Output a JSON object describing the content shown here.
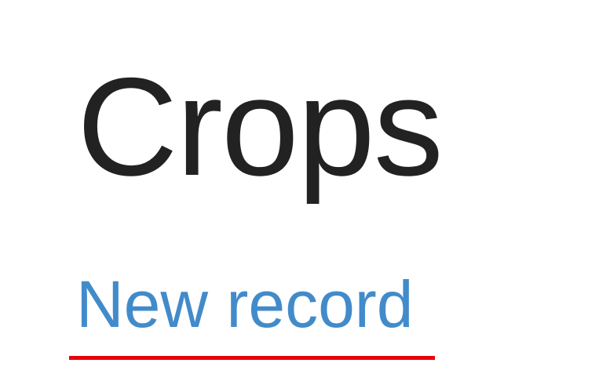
{
  "page": {
    "title": "Crops"
  },
  "actions": {
    "new_record_label": "New record"
  },
  "colors": {
    "title_text": "#222222",
    "link": "#428bca",
    "highlight": "#e8000b",
    "background": "#ffffff"
  }
}
